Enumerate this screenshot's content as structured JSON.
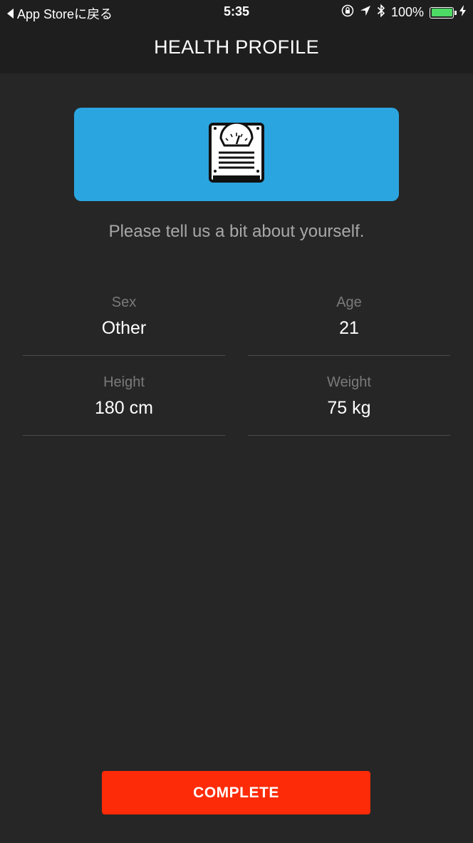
{
  "status_bar": {
    "back_label": "App Storeに戻る",
    "time": "5:35",
    "battery": "100%",
    "icons": [
      "orientation-lock-icon",
      "location-arrow-icon",
      "bluetooth-icon",
      "battery-icon",
      "charging-bolt-icon"
    ],
    "battery_color": "#4cd964"
  },
  "nav": {
    "title": "HEALTH PROFILE"
  },
  "hero": {
    "icon": "scale-icon",
    "background": "#2ba5df"
  },
  "intro": "Please tell us a bit about yourself.",
  "fields": {
    "sex": {
      "label": "Sex",
      "value": "Other"
    },
    "age": {
      "label": "Age",
      "value": "21"
    },
    "height": {
      "label": "Height",
      "value": "180 cm"
    },
    "weight": {
      "label": "Weight",
      "value": "75 kg"
    }
  },
  "complete_button": {
    "label": "COMPLETE",
    "color": "#fd2b08"
  }
}
